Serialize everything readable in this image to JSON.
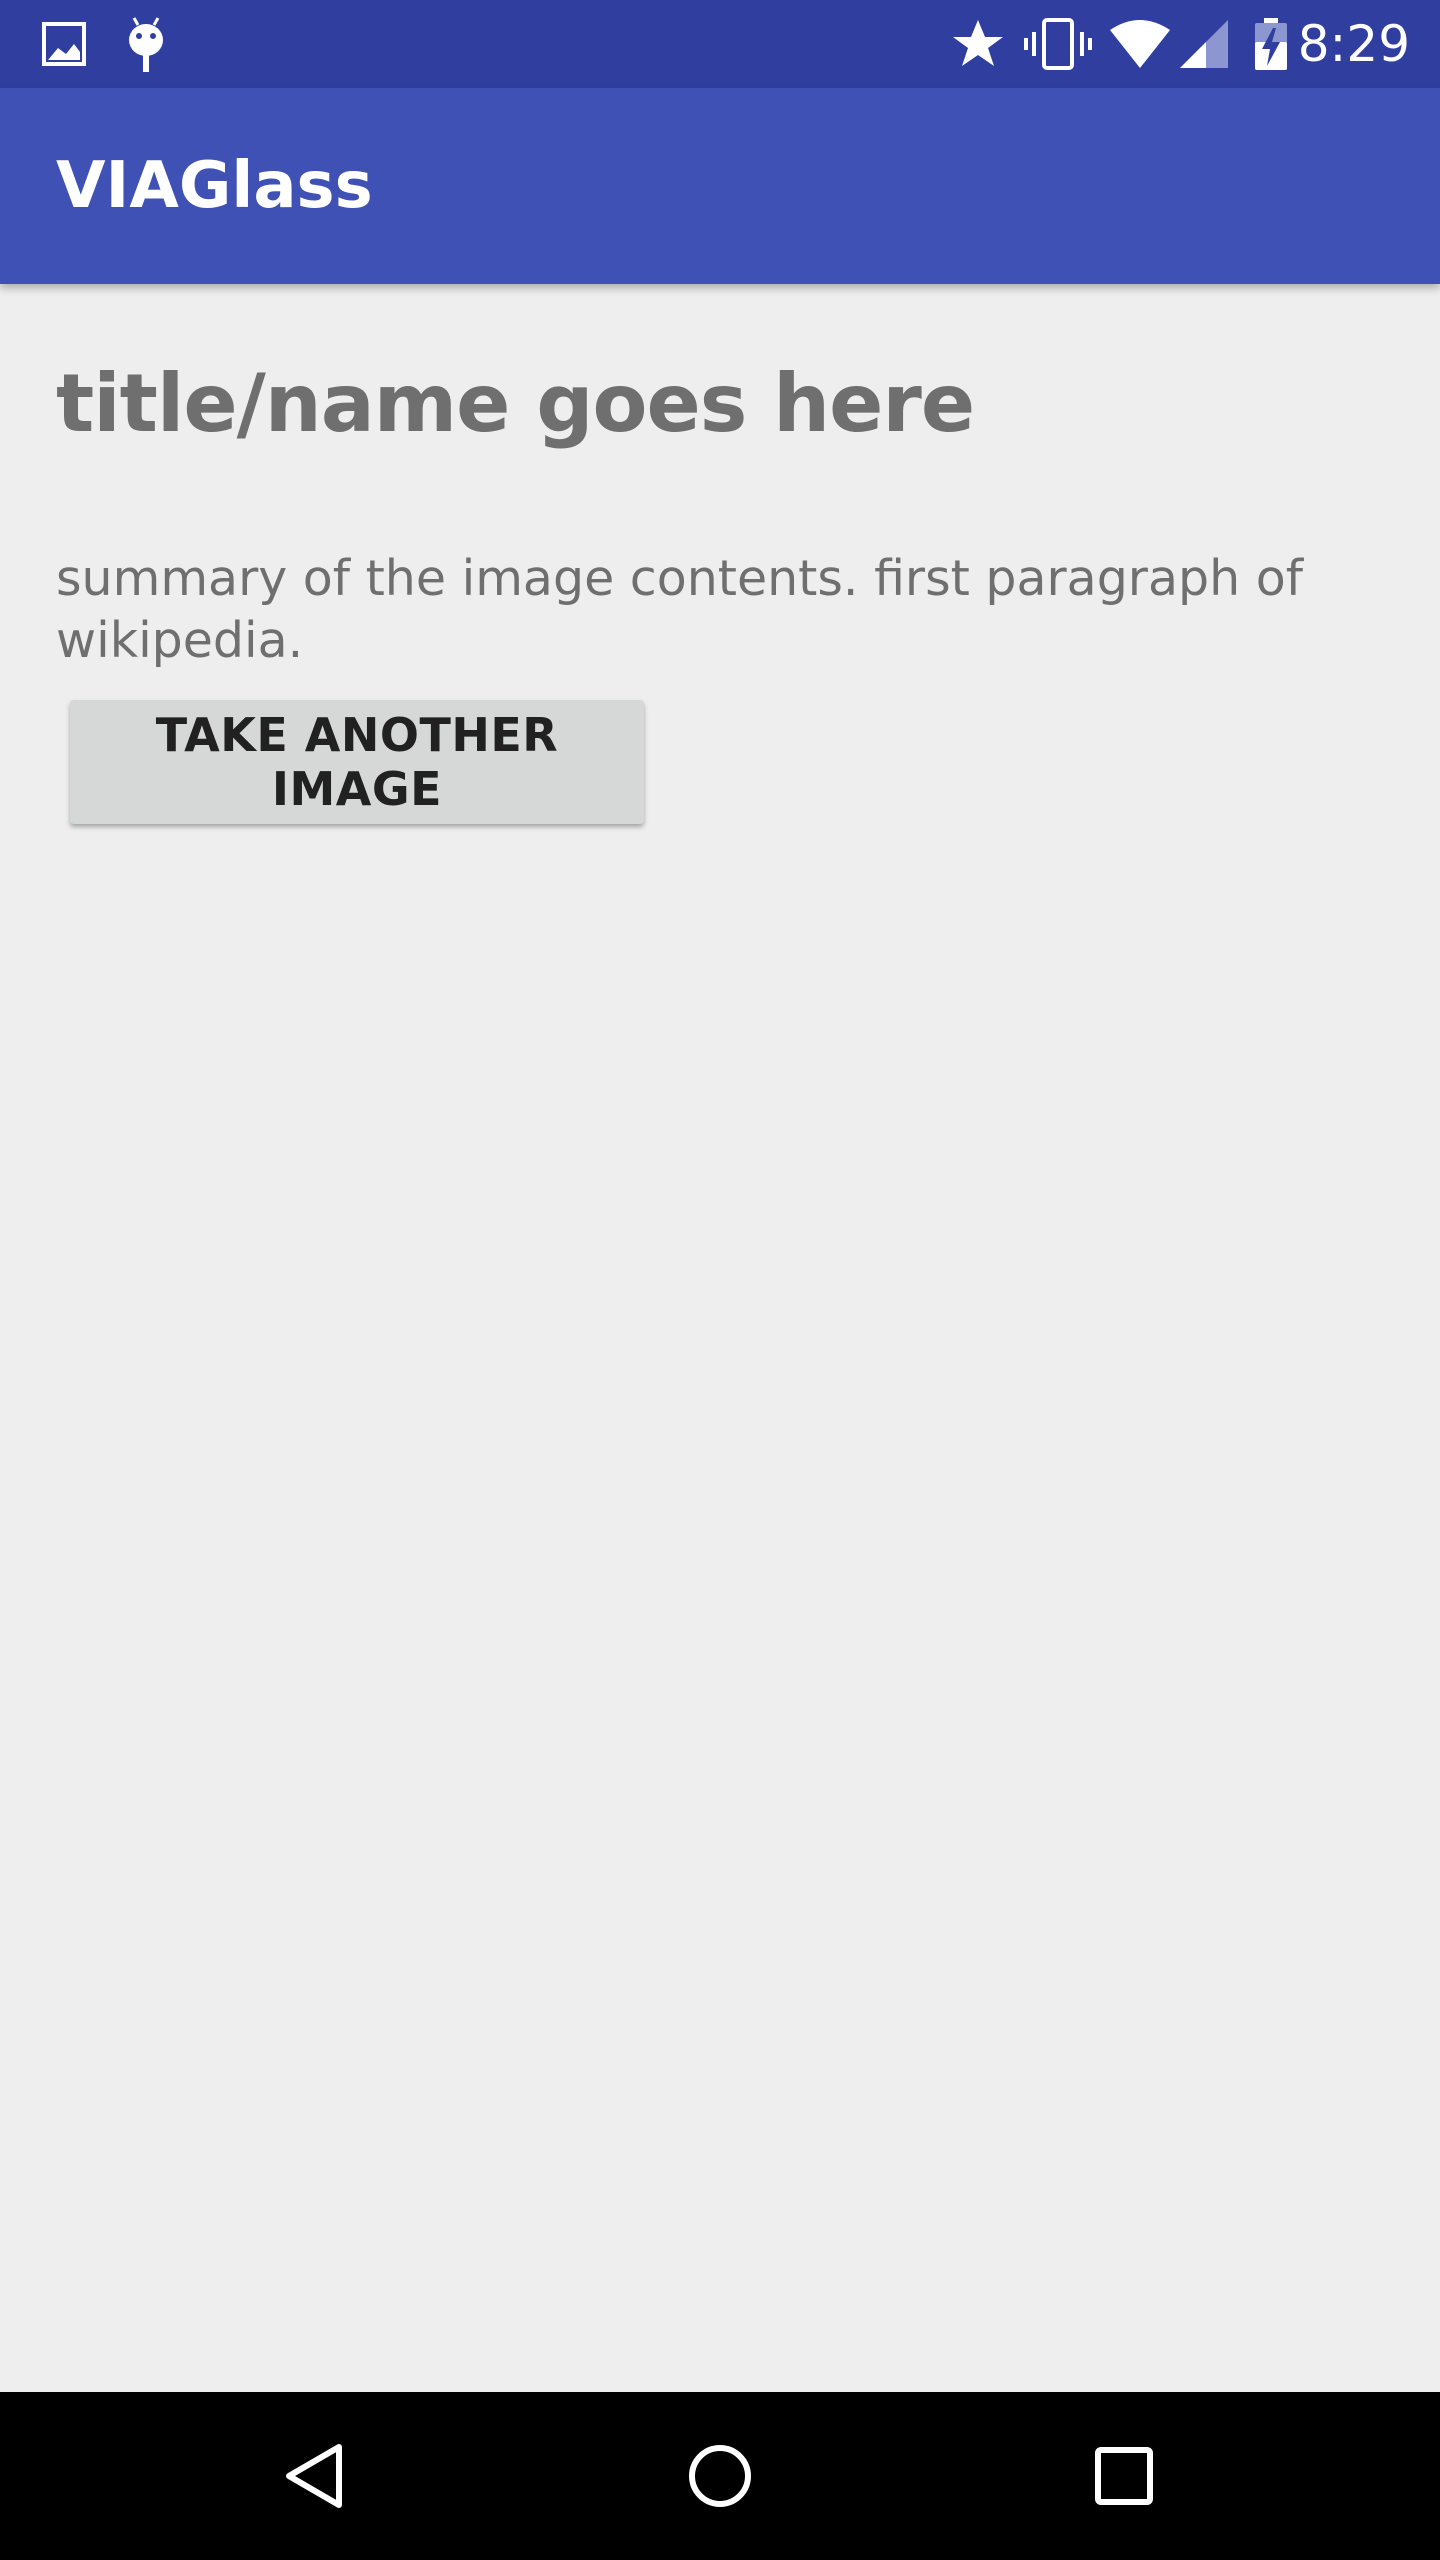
{
  "status_bar": {
    "time": "8:29",
    "left_icons": [
      "image-icon",
      "android-debug-icon"
    ],
    "right_icons": [
      "star-icon",
      "vibrate-icon",
      "wifi-icon",
      "signal-icon",
      "battery-charging-icon"
    ]
  },
  "app_bar": {
    "title": "VIAGlass",
    "color": "#3f51b5",
    "status_color": "#303f9f"
  },
  "main": {
    "title": "title/name goes here",
    "summary": "summary of the image contents. first paragraph of wikipedia.",
    "button_label": "TAKE ANOTHER IMAGE"
  },
  "nav_bar": {
    "buttons": [
      "back-icon",
      "home-icon",
      "recents-icon"
    ]
  }
}
